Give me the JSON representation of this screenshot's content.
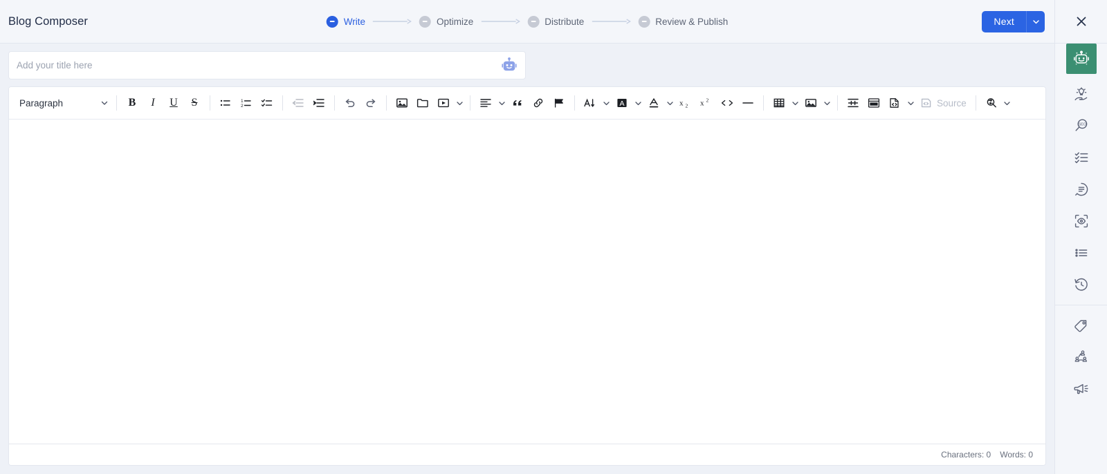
{
  "header": {
    "app_title": "Blog Composer",
    "next_label": "Next",
    "next_caret_icon": "chevron-down-icon",
    "close_icon": "close-icon"
  },
  "stepper": {
    "steps": [
      {
        "label": "Write",
        "state": "active"
      },
      {
        "label": "Optimize",
        "state": "inactive"
      },
      {
        "label": "Distribute",
        "state": "inactive"
      },
      {
        "label": "Review & Publish",
        "state": "inactive"
      }
    ],
    "active_color": "#2a5fe0",
    "inactive_color": "#c6cad4"
  },
  "title_field": {
    "value": "",
    "placeholder": "Add your title here",
    "assistant_icon": "robot-icon",
    "assistant_color": "#8da2e8"
  },
  "toolbar": {
    "paragraph_dropdown": {
      "label": "Paragraph",
      "caret_icon": "chevron-down-icon"
    },
    "source_label": "Source",
    "items": [
      {
        "name": "bold-button",
        "icon": "bold-icon",
        "text": "B"
      },
      {
        "name": "italic-button",
        "icon": "italic-icon",
        "text": "I"
      },
      {
        "name": "underline-button",
        "icon": "underline-icon",
        "text": "U"
      },
      {
        "name": "strikethrough-button",
        "icon": "strikethrough-icon",
        "text": "S"
      },
      {
        "name": "bulleted-list-button",
        "icon": "bulleted-list-icon"
      },
      {
        "name": "numbered-list-button",
        "icon": "numbered-list-icon"
      },
      {
        "name": "todo-list-button",
        "icon": "todo-list-icon"
      },
      {
        "name": "outdent-button",
        "icon": "outdent-icon"
      },
      {
        "name": "indent-button",
        "icon": "indent-icon"
      },
      {
        "name": "undo-button",
        "icon": "undo-icon"
      },
      {
        "name": "redo-button",
        "icon": "redo-icon"
      },
      {
        "name": "insert-image-button",
        "icon": "image-icon"
      },
      {
        "name": "open-file-browser-button",
        "icon": "folder-icon"
      },
      {
        "name": "insert-media-button",
        "icon": "media-icon"
      },
      {
        "name": "text-alignment-button",
        "icon": "align-left-icon"
      },
      {
        "name": "block-quote-button",
        "icon": "quote-icon"
      },
      {
        "name": "link-button",
        "icon": "link-icon"
      },
      {
        "name": "flag-button",
        "icon": "flag-icon"
      },
      {
        "name": "font-size-button",
        "icon": "font-size-icon"
      },
      {
        "name": "font-background-color-button",
        "icon": "highlight-icon"
      },
      {
        "name": "font-color-button",
        "icon": "font-color-icon"
      },
      {
        "name": "subscript-button",
        "icon": "subscript-icon"
      },
      {
        "name": "superscript-button",
        "icon": "superscript-icon"
      },
      {
        "name": "code-button",
        "icon": "code-icon"
      },
      {
        "name": "horizontal-line-button",
        "icon": "horizontal-rule-icon"
      },
      {
        "name": "insert-table-button",
        "icon": "table-icon"
      },
      {
        "name": "image-upload-button",
        "icon": "picture-icon"
      },
      {
        "name": "page-break-button",
        "icon": "page-break-icon"
      },
      {
        "name": "insert-template-button",
        "icon": "template-icon"
      },
      {
        "name": "html-embed-button",
        "icon": "html-embed-icon"
      },
      {
        "name": "source-button",
        "icon": "source-icon"
      },
      {
        "name": "find-replace-button",
        "icon": "find-replace-icon"
      }
    ]
  },
  "editor": {
    "content": "",
    "placeholder": ""
  },
  "status_bar": {
    "characters_label": "Characters: 0",
    "words_label": "Words: 0"
  },
  "rail": {
    "items": [
      {
        "name": "rail-ai-assistant",
        "icon": "robot-icon",
        "active": true
      },
      {
        "name": "rail-ideas",
        "icon": "lightbulb-hand-icon",
        "active": false
      },
      {
        "name": "rail-seo",
        "icon": "seo-magnifier-icon",
        "active": false
      },
      {
        "name": "rail-checklist",
        "icon": "checklist-icon",
        "active": false
      },
      {
        "name": "rail-summary",
        "icon": "document-circle-icon",
        "active": false
      },
      {
        "name": "rail-preview",
        "icon": "scan-eye-icon",
        "active": false
      },
      {
        "name": "rail-outline",
        "icon": "list-icon",
        "active": false
      },
      {
        "name": "rail-history",
        "icon": "history-clock-icon",
        "active": false
      },
      {
        "name": "rail-tags",
        "icon": "tag-icon",
        "active": false
      },
      {
        "name": "rail-audience",
        "icon": "org-chart-icon",
        "active": false
      },
      {
        "name": "rail-promote",
        "icon": "megaphone-icon",
        "active": false
      }
    ],
    "active_bg": "#3b8f72"
  }
}
